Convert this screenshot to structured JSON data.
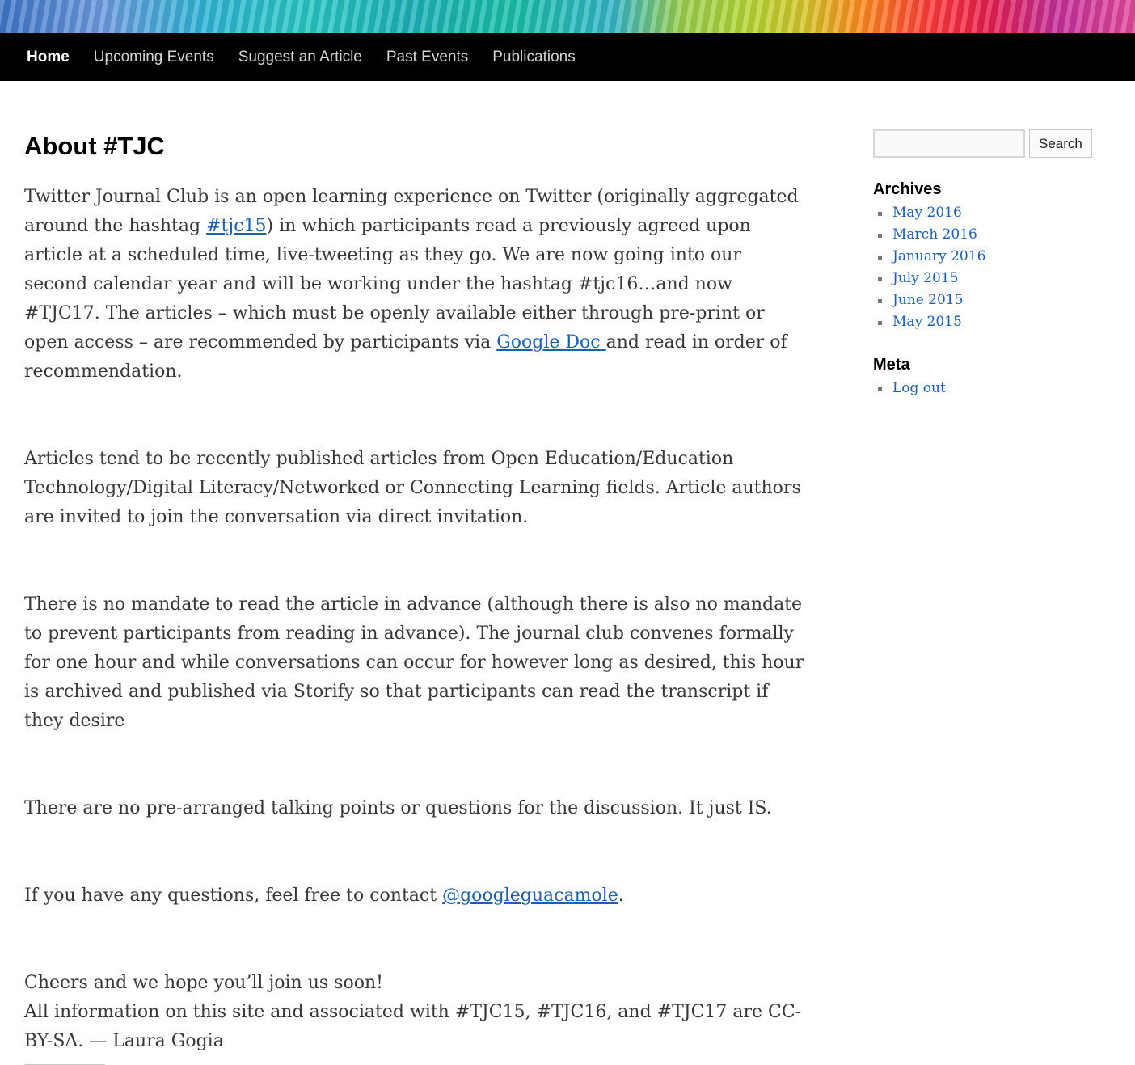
{
  "nav": {
    "items": [
      {
        "label": "Home",
        "active": true
      },
      {
        "label": "Upcoming Events"
      },
      {
        "label": "Suggest an Article"
      },
      {
        "label": "Past Events"
      },
      {
        "label": "Publications"
      }
    ]
  },
  "main": {
    "title": "About #TJC",
    "p1": {
      "t1": "Twitter Journal Club is an open learning experience on Twitter (originally aggregated around the hashtag ",
      "link1": "#tjc15",
      "t2": ") in which participants read a previously agreed upon article at a scheduled time, live-tweeting as they go.  We are now going into our second calendar year and will be working under the hashtag #tjc16…and now #TJC17. The articles – which must be openly available either through pre-print or open access – are recommended by participants via ",
      "link2": "Google Doc ",
      "t3": "and read in order of recommendation."
    },
    "p2": "Articles tend to be recently published articles from Open Education/Education Technology/Digital Literacy/Networked or Connecting Learning fields.  Article authors are invited to join the conversation via direct invitation.",
    "p3": "There is no mandate to read the article in advance (although there is also no mandate to prevent participants from reading in advance).  The journal club convenes formally for one hour and while conversations can occur for however long as desired, this hour is archived and published via Storify so that participants can read the transcript if they desire",
    "p4": "There are no pre-arranged talking points or questions for the discussion.  It just IS.",
    "p5": {
      "t1": "If you have any questions, feel free to contact ",
      "link": "@googleguacamole",
      "t2": "."
    },
    "p6_line1": "Cheers and we hope you’ll join us soon!",
    "p6_line2": "All information on this site and associated with #TJC15, #TJC16, and #TJC17 are CC-BY-SA. — Laura Gogia"
  },
  "sidebar": {
    "search": {
      "placeholder": "",
      "button": "Search"
    },
    "archives": {
      "title": "Archives",
      "items": [
        "May 2016",
        "March 2016",
        "January 2016",
        "July 2015",
        "June 2015",
        "May 2015"
      ]
    },
    "meta": {
      "title": "Meta",
      "items": [
        "Log out"
      ]
    }
  },
  "colors": {
    "link": "#1b5fb4",
    "nav_bg": "#000000",
    "text": "#373737"
  }
}
